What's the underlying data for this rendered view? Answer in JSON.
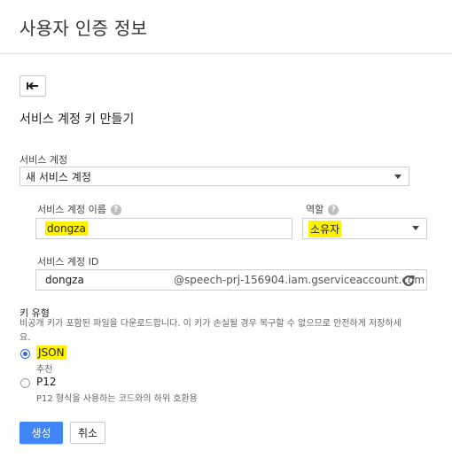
{
  "page": {
    "title": "사용자 인증 정보"
  },
  "back_button": {
    "icon": "back-arrow-icon"
  },
  "form": {
    "section_title": "서비스 계정 키 만들기",
    "service_account": {
      "label": "서비스 계정",
      "selected": "새 서비스 계정"
    },
    "account_name": {
      "label": "서비스 계정 이름",
      "value": "dongza"
    },
    "role": {
      "label": "역할",
      "selected": "소유자"
    },
    "account_id": {
      "label": "서비스 계정 ID",
      "value": "dongza",
      "suffix": "@speech-prj-156904.iam.gserviceaccount.com"
    },
    "key_type": {
      "label": "키 유형",
      "description": "비공개 키가 포함된 파일을 다운로드합니다. 이 키가 손실될 경우 복구할 수 없으므로 안전하게 저장하세요.",
      "options": [
        {
          "label": "JSON",
          "sublabel": "추천",
          "checked": true
        },
        {
          "label": "P12",
          "sublabel": "P12 형식을 사용하는 코드와의 하위 호환용",
          "checked": false
        }
      ]
    }
  },
  "actions": {
    "create": "생성",
    "cancel": "취소"
  },
  "colors": {
    "primary": "#4285f4",
    "highlight": "#fff200",
    "radio": "#3367d6"
  }
}
